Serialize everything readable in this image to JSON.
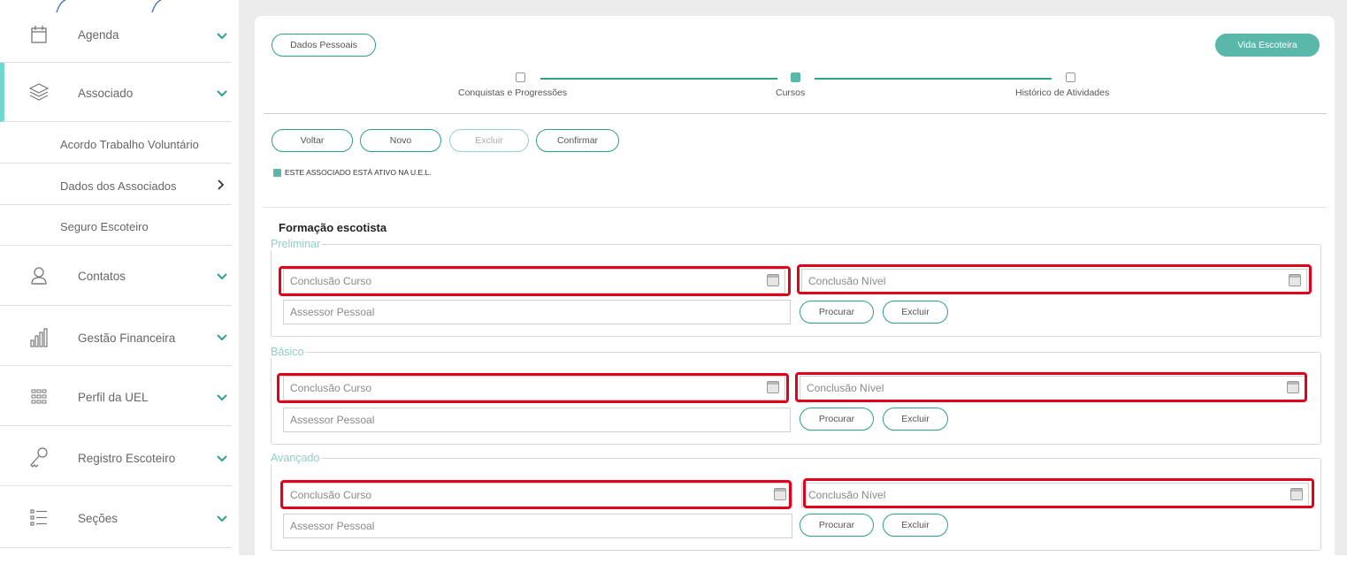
{
  "sidebar": {
    "items": [
      {
        "label": "Agenda",
        "icon": "calendar-icon"
      },
      {
        "label": "Associado",
        "icon": "layers-icon",
        "active": true
      },
      {
        "label": "Contatos",
        "icon": "user-icon"
      },
      {
        "label": "Gestão Financeira",
        "icon": "bar-chart-icon"
      },
      {
        "label": "Perfil da UEL",
        "icon": "grid-icon"
      },
      {
        "label": "Registro Escoteiro",
        "icon": "key-icon"
      },
      {
        "label": "Seções",
        "icon": "list-icon"
      }
    ],
    "subitems": [
      {
        "label": "Acordo Trabalho Voluntário"
      },
      {
        "label": "Dados dos Associados"
      },
      {
        "label": "Seguro Escoteiro"
      }
    ]
  },
  "header": {
    "dados_pessoais": "Dados Pessoais",
    "vida_escoteira": "Vida Escoteira"
  },
  "steps": [
    {
      "label": "Conquistas e Progressões",
      "active": false
    },
    {
      "label": "Cursos",
      "active": true
    },
    {
      "label": "Histórico de Atividades",
      "active": false
    }
  ],
  "actions": {
    "voltar": "Voltar",
    "novo": "Novo",
    "excluir": "Excluir",
    "confirmar": "Confirmar"
  },
  "status_text": "ESTE ASSOCIADO ESTÁ ATIVO NA U.E.L.",
  "section_title": "Formação escotista",
  "groups": [
    {
      "legend": "Preliminar",
      "conclusao_curso": "Conclusão Curso",
      "conclusao_nivel": "Conclusão Nível",
      "assessor": "Assessor Pessoal",
      "procurar": "Procurar",
      "excluir": "Excluir"
    },
    {
      "legend": "Básico",
      "conclusao_curso": "Conclusão Curso",
      "conclusao_nivel": "Conclusão Nível",
      "assessor": "Assessor Pessoal",
      "procurar": "Procurar",
      "excluir": "Excluir"
    },
    {
      "legend": "Avançado",
      "conclusao_curso": "Conclusão Curso",
      "conclusao_nivel": "Conclusão Nível",
      "assessor": "Assessor Pessoal",
      "procurar": "Procurar",
      "excluir": "Excluir"
    }
  ],
  "colors": {
    "accent": "#2c9f8f",
    "accent_fill": "#5ab8aa",
    "active_bar": "#72d7cf",
    "highlight": "#e3001b"
  }
}
